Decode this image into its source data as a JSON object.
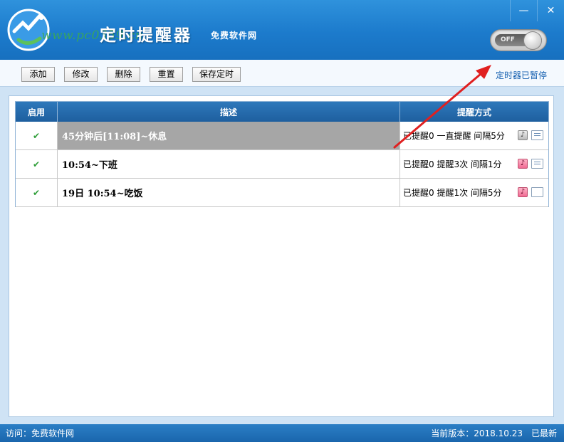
{
  "window": {
    "title": "定时提醒器",
    "subtitle": "免费软件网",
    "watermark": "www.pc0359.cn",
    "minimize_glyph": "—",
    "close_glyph": "✕"
  },
  "toggle": {
    "label": "OFF",
    "state": "off"
  },
  "toolbar": {
    "buttons": [
      "添加",
      "修改",
      "删除",
      "重置",
      "保存定时"
    ],
    "status": "定时器已暂停"
  },
  "grid": {
    "columns": [
      "启用",
      "描述",
      "提醒方式"
    ],
    "rows": [
      {
        "enabled": "✔",
        "description": "45分钟后[11:08]~休息",
        "method": "已提醒0  一直提醒  间隔5分",
        "sound_icon": "music-off-icon",
        "popup_icon": "popup-lines-icon",
        "selected": true
      },
      {
        "enabled": "✔",
        "description": "10:54~下班",
        "method": "已提醒0  提醒3次  间隔1分",
        "sound_icon": "music-on-icon",
        "popup_icon": "popup-lines-icon",
        "selected": false
      },
      {
        "enabled": "✔",
        "description": "19日 10:54~吃饭",
        "method": "已提醒0  提醒1次  间隔5分",
        "sound_icon": "music-on-icon",
        "popup_icon": "popup-blank-icon",
        "selected": false
      }
    ]
  },
  "statusbar": {
    "visit": "访问：免费软件网",
    "version": "当前版本：2018.10.23",
    "latest": "已最新"
  },
  "colors": {
    "title_bar": "#1c7bcc",
    "status_text": "#1560b0",
    "selected_row": "#a6a6a6",
    "annotation_arrow": "#e02020"
  }
}
